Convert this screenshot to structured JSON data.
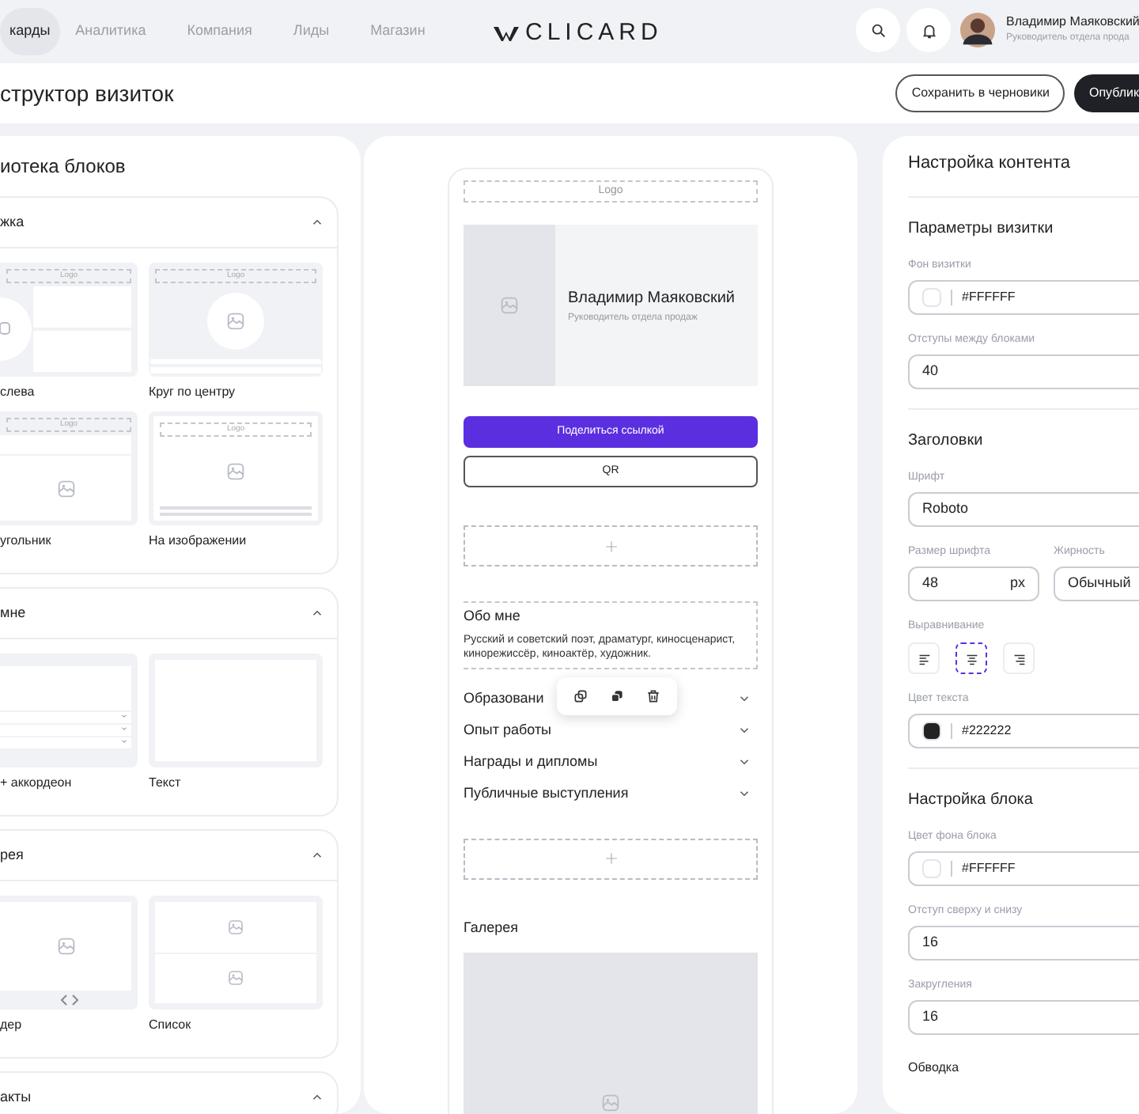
{
  "nav": {
    "tabs": [
      {
        "label": "карды",
        "selected": true
      },
      {
        "label": "Аналитика",
        "selected": false
      },
      {
        "label": "Компания",
        "selected": false
      },
      {
        "label": "Лиды",
        "selected": false
      },
      {
        "label": "Магазин",
        "selected": false
      }
    ],
    "logo": "CLICARD",
    "user": {
      "name": "Владимир Маяковский",
      "role": "Руководитель отдела прода"
    }
  },
  "header": {
    "title": "структор визиток",
    "buttons": [
      {
        "label": "Сохранить в черновики",
        "kind": "outline"
      },
      {
        "label": "Опублик",
        "kind": "primary"
      }
    ]
  },
  "library": {
    "title": "иотека блоков",
    "sections": [
      {
        "title": "жка",
        "expanded": true,
        "blocks": [
          {
            "label": "слева",
            "kind": "cover-left",
            "logo": "Logo"
          },
          {
            "label": "Круг по центру",
            "kind": "cover-circle",
            "logo": "Logo"
          },
          {
            "label": "угольник",
            "kind": "cover-rect",
            "logo": "Logo"
          },
          {
            "label": "На изображении",
            "kind": "cover-image",
            "logo": "Logo"
          }
        ]
      },
      {
        "title": "мне",
        "expanded": true,
        "blocks": [
          {
            "label": "+ аккордеон",
            "kind": "text-accordion"
          },
          {
            "label": "Текст",
            "kind": "text"
          }
        ]
      },
      {
        "title": "рея",
        "expanded": true,
        "blocks": [
          {
            "label": "дер",
            "kind": "gallery-slider"
          },
          {
            "label": "Список",
            "kind": "gallery-list"
          }
        ]
      },
      {
        "title": "акты",
        "expanded": true
      }
    ]
  },
  "preview": {
    "logo": "Logo",
    "profile": {
      "name": "Владимир Маяковский",
      "role": "Руководитель отдела продаж"
    },
    "buttons": [
      {
        "label": "Поделиться ссылкой",
        "kind": "primary"
      },
      {
        "label": "QR",
        "kind": "outline"
      }
    ],
    "about": {
      "title": "Обо мне",
      "text": "Русский и советский поэт, драматург, киносценарист, кинорежиссёр, киноактёр, художник."
    },
    "accordion": [
      {
        "title": "Образовани",
        "expanded": false
      },
      {
        "title": "Опыт работы",
        "expanded": false
      },
      {
        "title": "Награды и дипломы",
        "expanded": false
      },
      {
        "title": "Публичные выступления",
        "expanded": false
      }
    ],
    "gallery_title": "Галерея"
  },
  "settings": {
    "title": "Настройка контента",
    "groups": [
      {
        "title": "Параметры визитки",
        "fields": [
          {
            "kind": "color",
            "label": "Фон визитки",
            "value": "#FFFFFF",
            "color": "#ffffff"
          },
          {
            "kind": "text",
            "label": "Отступы между блоками",
            "value": "40"
          }
        ]
      },
      {
        "title": "Заголовки",
        "fields": [
          {
            "kind": "text",
            "label": "Шрифт",
            "value": "Roboto"
          },
          {
            "kind": "pair",
            "label": "Размер шрифта",
            "value": "48",
            "unit": "px",
            "label2": "Жирность",
            "value2": "Обычный"
          },
          {
            "kind": "align",
            "label": "Выравнивание",
            "options": [
              {
                "kind": "left",
                "selected": false
              },
              {
                "kind": "center",
                "selected": true
              },
              {
                "kind": "right",
                "selected": false
              }
            ]
          },
          {
            "kind": "color",
            "label": "Цвет текста",
            "value": "#222222",
            "color": "#222222"
          }
        ]
      },
      {
        "title": "Настройка блока",
        "fields": [
          {
            "kind": "color",
            "label": "Цвет фона блока",
            "value": "#FFFFFF",
            "color": "#ffffff"
          },
          {
            "kind": "text",
            "label": "Отступ сверху и снизу",
            "value": "16"
          },
          {
            "kind": "text",
            "label": "Закругления",
            "value": "16"
          },
          {
            "kind": "heading",
            "label": "Обводка"
          }
        ]
      }
    ]
  }
}
